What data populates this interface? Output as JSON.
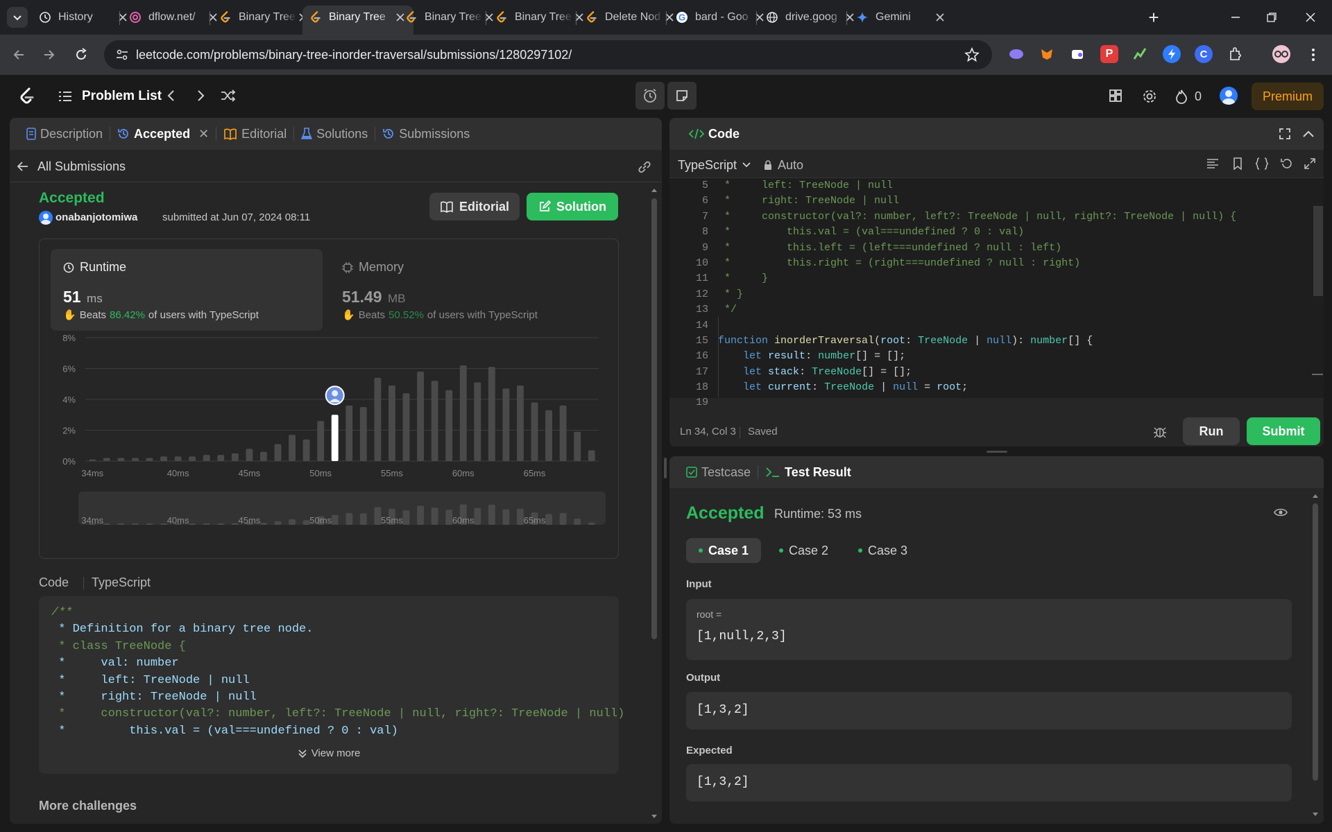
{
  "browser": {
    "tabs": [
      {
        "title": "History",
        "icon": "history-icon"
      },
      {
        "title": "dflow.net/",
        "icon": "dflow-icon"
      },
      {
        "title": "Binary Tree",
        "icon": "leetcode-icon"
      },
      {
        "title": "Binary Tree",
        "icon": "leetcode-icon",
        "active": true
      },
      {
        "title": "Binary Tree",
        "icon": "leetcode-icon"
      },
      {
        "title": "Binary Tree",
        "icon": "leetcode-icon"
      },
      {
        "title": "Delete Nod",
        "icon": "leetcode-icon"
      },
      {
        "title": "bard - Goo",
        "icon": "google-icon"
      },
      {
        "title": "drive.goog",
        "icon": "globe-icon"
      },
      {
        "title": "Gemini",
        "icon": "gemini-icon"
      }
    ],
    "url": "leetcode.com/problems/binary-tree-inorder-traversal/submissions/1280297102/"
  },
  "nav": {
    "problem_list": "Problem List",
    "streak_count": "0",
    "premium": "Premium"
  },
  "left": {
    "tabs": {
      "description": "Description",
      "accepted": "Accepted",
      "editorial": "Editorial",
      "solutions": "Solutions",
      "submissions": "Submissions"
    },
    "all_submissions": "All Submissions",
    "status": "Accepted",
    "user": "onabanjotomiwa",
    "submitted_text": "submitted at Jun 07, 2024 08:11",
    "editorial_btn": "Editorial",
    "solution_btn": "Solution",
    "runtime": {
      "label": "Runtime",
      "value": "51",
      "unit": "ms",
      "beats_prefix": "Beats",
      "beats_pct": "86.42%",
      "beats_suffix": "of users with TypeScript"
    },
    "memory": {
      "label": "Memory",
      "value": "51.49",
      "unit": "MB",
      "beats_prefix": "Beats",
      "beats_pct": "50.52%",
      "beats_suffix": "of users with TypeScript"
    },
    "code_label": "Code",
    "code_lang": "TypeScript",
    "code_lines": [
      "/**",
      " * Definition for a binary tree node.",
      " * class TreeNode {",
      " *     val: number",
      " *     left: TreeNode | null",
      " *     right: TreeNode | null",
      " *     constructor(val?: number, left?: TreeNode | null, right?: TreeNode | null)",
      " *         this.val = (val===undefined ? 0 : val)"
    ],
    "view_more": "View more",
    "more_challenges": "More challenges"
  },
  "chart_data": {
    "type": "bar",
    "title": "",
    "xlabel": "",
    "ylabel": "",
    "y_ticks": [
      "0%",
      "2%",
      "4%",
      "6%",
      "8%"
    ],
    "ylim": [
      0,
      8
    ],
    "x_tick_labels": [
      "34ms",
      "40ms",
      "45ms",
      "50ms",
      "55ms",
      "60ms",
      "65ms"
    ],
    "x_tick_values": [
      34,
      40,
      45,
      50,
      55,
      60,
      65
    ],
    "x": [
      34,
      35,
      36,
      37,
      38,
      39,
      40,
      41,
      42,
      43,
      44,
      45,
      46,
      47,
      48,
      49,
      50,
      51,
      52,
      53,
      54,
      55,
      56,
      57,
      58,
      59,
      60,
      61,
      62,
      63,
      64,
      65,
      66,
      67,
      68
    ],
    "values": [
      0.1,
      0.2,
      0.2,
      0.2,
      0.2,
      0.3,
      0.3,
      0.3,
      0.4,
      0.4,
      0.5,
      0.8,
      0.6,
      1.1,
      1.7,
      1.4,
      2.6,
      3.0,
      3.6,
      3.5,
      5.4,
      4.9,
      4.4,
      5.8,
      5.2,
      4.6,
      6.2,
      5.1,
      6.1,
      4.7,
      4.9,
      3.8,
      3.3,
      3.6,
      1.9,
      0.7
    ],
    "highlighted_x": 51,
    "highlight_color": "#ffffff",
    "bar_color": "#4a4a4a",
    "grid": true,
    "minimap": true
  },
  "editor": {
    "header": "Code",
    "language": "TypeScript",
    "mode": "Auto",
    "lines": [
      {
        "n": "5",
        "t": " *     left: TreeNode | null"
      },
      {
        "n": "6",
        "t": " *     right: TreeNode | null"
      },
      {
        "n": "7",
        "t": " *     constructor(val?: number, left?: TreeNode | null, right?: TreeNode | null) {"
      },
      {
        "n": "8",
        "t": " *         this.val = (val===undefined ? 0 : val)"
      },
      {
        "n": "9",
        "t": " *         this.left = (left===undefined ? null : left)"
      },
      {
        "n": "10",
        "t": " *         this.right = (right===undefined ? null : right)"
      },
      {
        "n": "11",
        "t": " *     }"
      },
      {
        "n": "12",
        "t": " * }"
      },
      {
        "n": "13",
        "t": " */"
      },
      {
        "n": "14",
        "t": ""
      },
      {
        "n": "15",
        "t": "function inorderTraversal(root: TreeNode | null): number[] {"
      },
      {
        "n": "16",
        "t": "    let result: number[] = [];"
      },
      {
        "n": "17",
        "t": "    let stack: TreeNode[] = [];"
      },
      {
        "n": "18",
        "t": "    let current: TreeNode | null = root;"
      },
      {
        "n": "19",
        "t": ""
      }
    ],
    "cursor": "Ln 34, Col 3",
    "saved": "Saved",
    "run": "Run",
    "submit": "Submit"
  },
  "result": {
    "tab_testcase": "Testcase",
    "tab_result": "Test Result",
    "status": "Accepted",
    "runtime": "Runtime: 53 ms",
    "cases": [
      "Case 1",
      "Case 2",
      "Case 3"
    ],
    "input_label": "Input",
    "input_var": "root =",
    "input_value": "[1,null,2,3]",
    "output_label": "Output",
    "output_value": "[1,3,2]",
    "expected_label": "Expected",
    "expected_value": "[1,3,2]"
  }
}
